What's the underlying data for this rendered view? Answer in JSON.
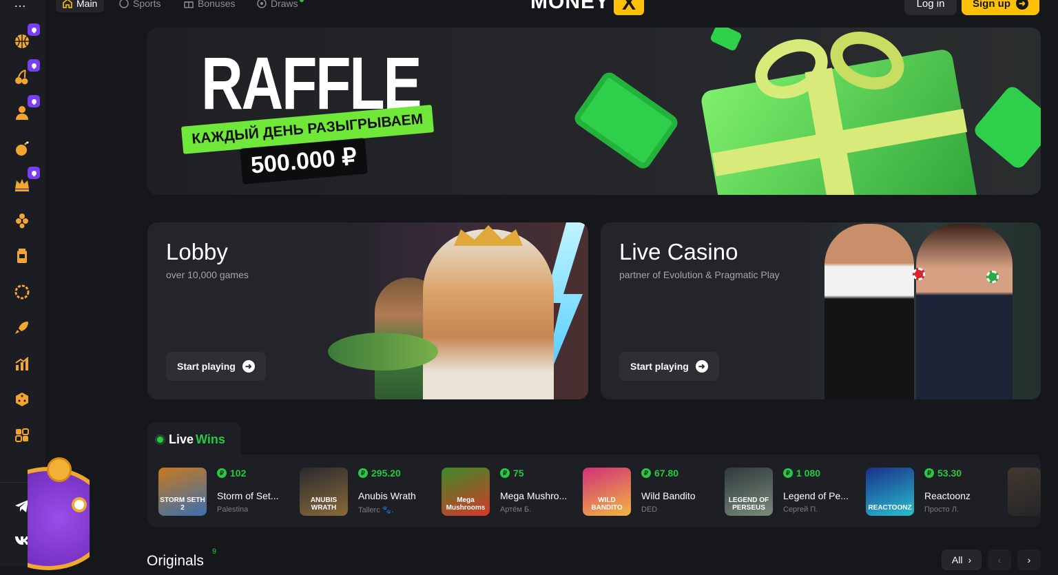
{
  "header": {
    "tabs": [
      {
        "label": "Main",
        "icon": "home-icon"
      },
      {
        "label": "Sports",
        "icon": "ball-icon"
      },
      {
        "label": "Bonuses",
        "icon": "gift-icon"
      },
      {
        "label": "Draws",
        "icon": "draws-icon"
      }
    ],
    "logo_text": "MONEY",
    "logo_mark": "X",
    "login_label": "Log in",
    "signup_label": "Sign up"
  },
  "sidebar": {
    "menu_icon": "…",
    "items": [
      {
        "icon": "basketball-icon",
        "badge": true
      },
      {
        "icon": "cherry-icon",
        "badge": true
      },
      {
        "icon": "dealer-icon",
        "badge": true
      },
      {
        "icon": "bomb-icon",
        "badge": false
      },
      {
        "icon": "crown-icon",
        "badge": true
      },
      {
        "icon": "coins-stack-icon",
        "badge": false
      },
      {
        "icon": "slot-machine-icon",
        "badge": false
      },
      {
        "icon": "roulette-icon",
        "badge": false
      },
      {
        "icon": "rocket-icon",
        "badge": false
      },
      {
        "icon": "chart-icon",
        "badge": false
      },
      {
        "icon": "dice-icon",
        "badge": false
      },
      {
        "icon": "puzzle-icon",
        "badge": false
      }
    ],
    "social": [
      {
        "icon": "telegram-icon"
      },
      {
        "icon": "vk-icon"
      }
    ]
  },
  "banner": {
    "title": "RAFFLE",
    "strip": "КАЖДЫЙ ДЕНЬ РАЗЫГРЫВАЕМ",
    "amount": "500.000 ₽"
  },
  "cards": [
    {
      "title": "Lobby",
      "subtitle": "over 10,000 games",
      "button": "Start playing"
    },
    {
      "title": "Live Casino",
      "subtitle": "partner of Evolution & Pragmatic Play",
      "button": "Start playing"
    }
  ],
  "live_wins": {
    "title_a": "Live",
    "title_b": "Wins",
    "currency_symbol": "₽",
    "items": [
      {
        "amount": "102",
        "game": "Storm of Set...",
        "user": "Palestina",
        "thumb_text": "STORM SETH 2",
        "thumb_colors": [
          "#c9791c",
          "#3a6fb0"
        ]
      },
      {
        "amount": "295.20",
        "game": "Anubis Wrath",
        "user": "Tallerc 🐾.",
        "thumb_text": "ANUBIS WRATH",
        "thumb_colors": [
          "#2a2a2e",
          "#8a6a3a"
        ]
      },
      {
        "amount": "75",
        "game": "Mega Mushro...",
        "user": "Артём Б.",
        "thumb_text": "Mega Mushrooms",
        "thumb_colors": [
          "#3f8a2a",
          "#d23a2a"
        ]
      },
      {
        "amount": "67.80",
        "game": "Wild Bandito",
        "user": "DED",
        "thumb_text": "WILD BANDITO",
        "thumb_colors": [
          "#d0307a",
          "#f2b640"
        ]
      },
      {
        "amount": "1 080",
        "game": "Legend of Pe...",
        "user": "Сергей П.",
        "thumb_text": "LEGEND OF PERSEUS",
        "thumb_colors": [
          "#2e3a3c",
          "#7a8a7a"
        ]
      },
      {
        "amount": "53.30",
        "game": "Reactoonz",
        "user": "Просто Л.",
        "thumb_text": "REACTOONZ",
        "thumb_colors": [
          "#1a2f8a",
          "#28c0d0"
        ]
      }
    ]
  },
  "originals": {
    "title": "Originals",
    "count": "9",
    "all_label": "All"
  },
  "colors": {
    "accent": "#ffc107",
    "win_green": "#28c840",
    "badge_purple": "#7b3ff2",
    "bg": "#16171b",
    "panel": "#1e1f24"
  }
}
